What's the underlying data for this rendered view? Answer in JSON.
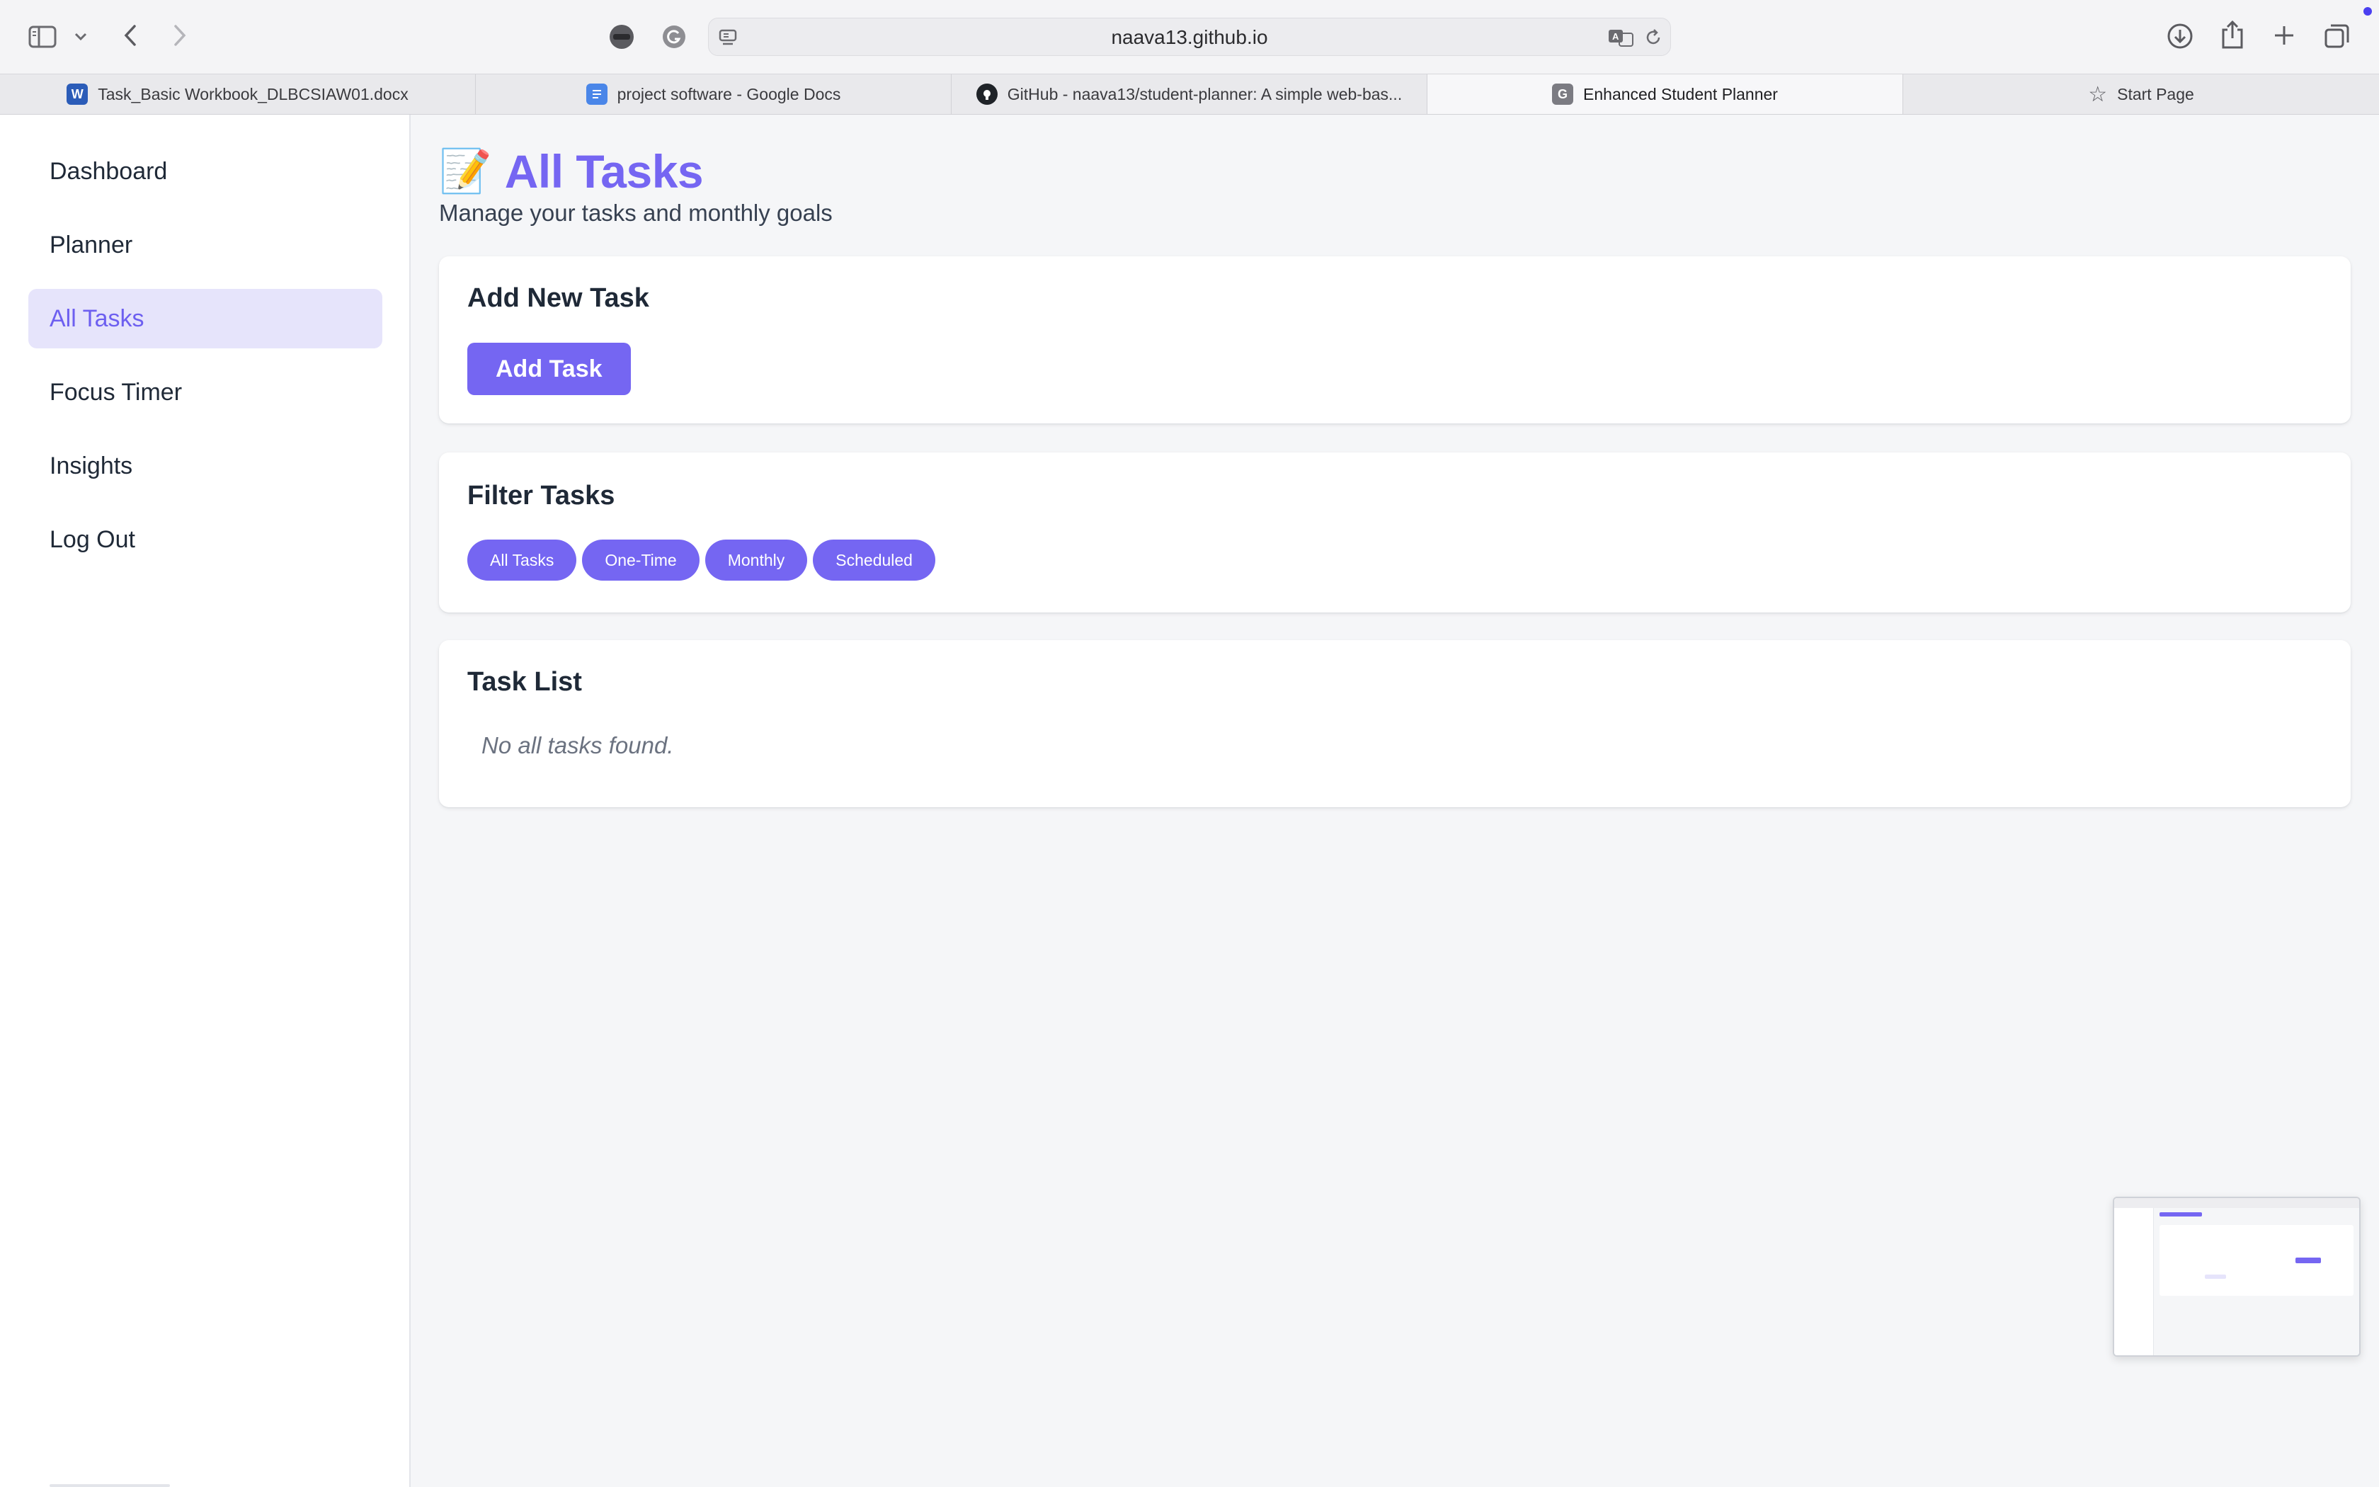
{
  "browser": {
    "url": "naava13.github.io",
    "tabs": [
      {
        "label": "Task_Basic Workbook_DLBCSIAW01.docx",
        "favicon": "word-icon"
      },
      {
        "label": "project software - Google Docs",
        "favicon": "google-docs-icon"
      },
      {
        "label": "GitHub - naava13/student-planner: A simple web-bas...",
        "favicon": "github-icon"
      },
      {
        "label": "Enhanced Student Planner",
        "favicon": "g-letter-icon",
        "favicon_text": "G"
      },
      {
        "label": "Start Page",
        "favicon": "star-icon",
        "favicon_text": "☆"
      }
    ],
    "active_tab": 3
  },
  "sidebar": {
    "items": [
      {
        "label": "Dashboard"
      },
      {
        "label": "Planner"
      },
      {
        "label": "All Tasks"
      },
      {
        "label": "Focus Timer"
      },
      {
        "label": "Insights"
      },
      {
        "label": "Log Out"
      }
    ],
    "active_item": "All Tasks"
  },
  "main": {
    "title_emoji": "📝",
    "title": "All Tasks",
    "subtitle": "Manage your tasks and monthly goals",
    "add_card": {
      "heading": "Add New Task",
      "button": "Add Task"
    },
    "filter_card": {
      "heading": "Filter Tasks",
      "filters": [
        "All Tasks",
        "One-Time",
        "Monthly",
        "Scheduled"
      ]
    },
    "list_card": {
      "heading": "Task List",
      "empty_message": "No all tasks found."
    }
  },
  "colors": {
    "accent": "#7566f2",
    "active_nav_bg": "#e6e4fb",
    "page_bg": "#f5f6f8"
  }
}
